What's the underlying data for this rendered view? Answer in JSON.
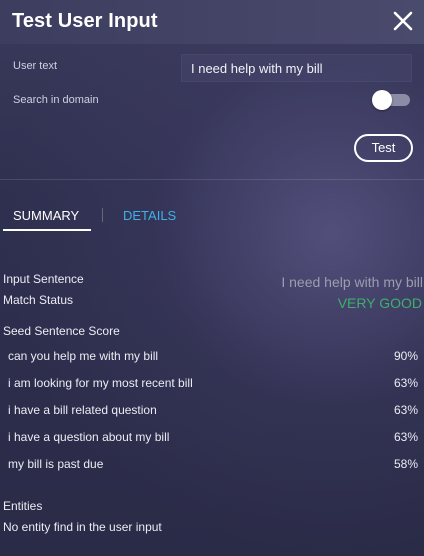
{
  "window": {
    "title": "Test User Input",
    "close_icon": "close-icon"
  },
  "form": {
    "user_text_label": "User text",
    "user_text_value": "I need help with my bill",
    "search_domain_label": "Search in domain",
    "search_domain_on": false,
    "test_button_label": "Test"
  },
  "tabs": {
    "summary_label": "SUMMARY",
    "details_label": "DETAILS",
    "active": "summary"
  },
  "summary": {
    "input_sentence_label": "Input Sentence",
    "input_sentence_value": "I need help with my bill",
    "match_status_label": "Match Status",
    "match_status_value": "VERY GOOD",
    "seed_score_label": "Seed Sentence Score",
    "seeds": [
      {
        "text": "can you help me with my bill",
        "score": "90%"
      },
      {
        "text": "i am looking for my most recent bill",
        "score": "63%"
      },
      {
        "text": "i have a bill related question",
        "score": "63%"
      },
      {
        "text": "i have a question about my bill",
        "score": "63%"
      },
      {
        "text": "my bill is past due",
        "score": "58%"
      }
    ],
    "entities_label": "Entities",
    "entities_value": "No entity find in the user input"
  },
  "colors": {
    "accent_tab": "#3fb0e8",
    "match_good": "#3db06a",
    "input_value": "#9c9db0"
  }
}
